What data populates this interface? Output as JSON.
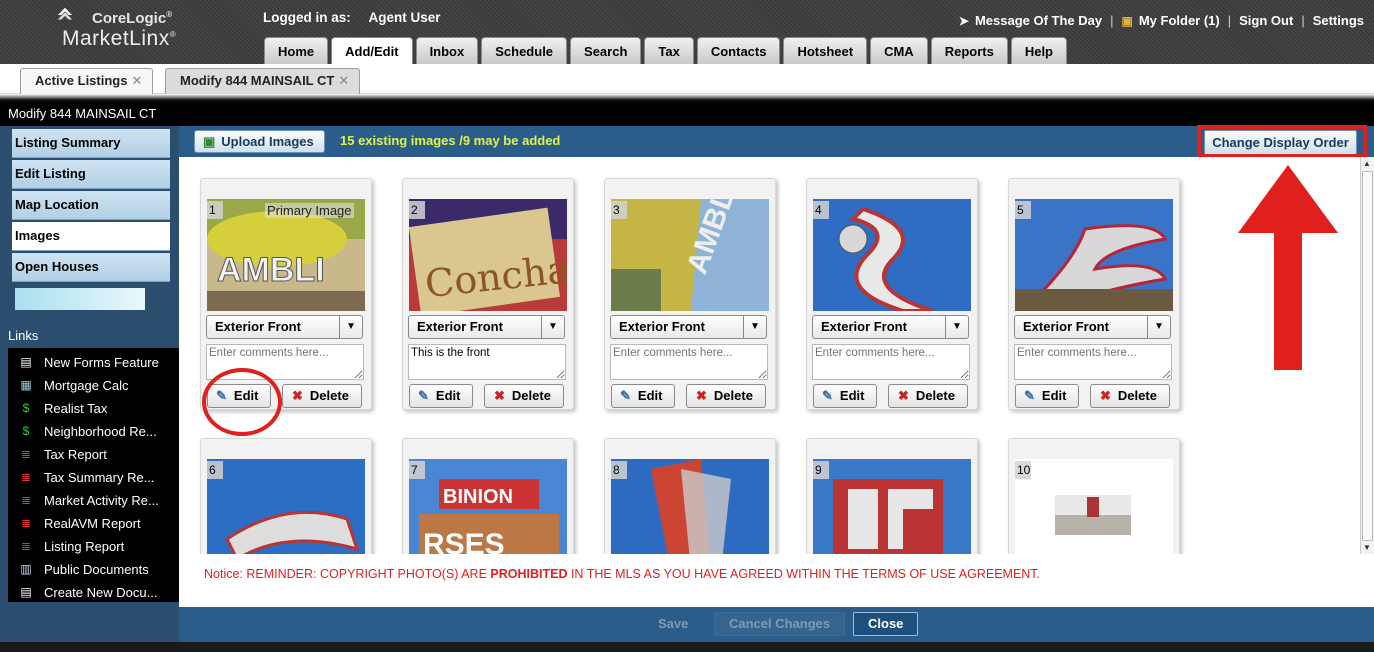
{
  "app": {
    "brand_top": "CoreLogic",
    "brand_bottom": "MarketLinx",
    "logged_label": "Logged in as:",
    "logged_user": "Agent User"
  },
  "toplinks": {
    "motd": "Message Of The Day",
    "folder": "My Folder (1)",
    "signout": "Sign Out",
    "settings": "Settings"
  },
  "nav": {
    "tabs": [
      "Home",
      "Add/Edit",
      "Inbox",
      "Schedule",
      "Search",
      "Tax",
      "Contacts",
      "Hotsheet",
      "CMA",
      "Reports",
      "Help"
    ],
    "active": "Add/Edit"
  },
  "doc_tabs": [
    {
      "label": "Active Listings"
    },
    {
      "label": "Modify 844 MAINSAIL CT"
    }
  ],
  "page_title": "Modify 844 MAINSAIL CT",
  "sidebar": {
    "items": [
      "Listing Summary",
      "Edit Listing",
      "Map Location",
      "Images",
      "Open Houses"
    ],
    "active": "Images",
    "links_header": "Links",
    "links": [
      {
        "label": "New Forms Feature",
        "icon": "document-icon"
      },
      {
        "label": "Mortgage Calc",
        "icon": "calculator-icon"
      },
      {
        "label": "Realist Tax",
        "icon": "dollar-icon"
      },
      {
        "label": "Neighborhood Re...",
        "icon": "dollar-icon"
      },
      {
        "label": "Tax Report",
        "icon": "report-icon"
      },
      {
        "label": "Tax Summary Re...",
        "icon": "report-icon"
      },
      {
        "label": "Market Activity Re...",
        "icon": "report-icon"
      },
      {
        "label": "RealAVM Report",
        "icon": "report-icon"
      },
      {
        "label": "Listing Report",
        "icon": "report-icon"
      },
      {
        "label": "Public Documents",
        "icon": "folder-doc-icon"
      },
      {
        "label": "Create New Docu...",
        "icon": "document-icon"
      }
    ]
  },
  "toolbar": {
    "upload_label": "Upload Images",
    "image_count": "15 existing images /9 may be added",
    "order_label": "Change Display Order"
  },
  "images": [
    {
      "num": "1",
      "primary": "Primary Image",
      "category": "Exterior Front",
      "comment": "",
      "placeholder": "Enter comments here..."
    },
    {
      "num": "2",
      "primary": "",
      "category": "Exterior Front",
      "comment": "This is the front",
      "placeholder": "Enter comments here..."
    },
    {
      "num": "3",
      "primary": "",
      "category": "Exterior Front",
      "comment": "",
      "placeholder": "Enter comments here..."
    },
    {
      "num": "4",
      "primary": "",
      "category": "Exterior Front",
      "comment": "",
      "placeholder": "Enter comments here..."
    },
    {
      "num": "5",
      "primary": "",
      "category": "Exterior Front",
      "comment": "",
      "placeholder": "Enter comments here..."
    },
    {
      "num": "6"
    },
    {
      "num": "7"
    },
    {
      "num": "8"
    },
    {
      "num": "9"
    },
    {
      "num": "10"
    }
  ],
  "card_buttons": {
    "edit": "Edit",
    "delete": "Delete"
  },
  "notice": {
    "prefix": "Notice: REMINDER: COPYRIGHT PHOTO(S) ARE ",
    "bold": "PROHIBITED",
    "suffix": " IN THE  MLS AS YOU HAVE AGREED WITHIN THE TERMS OF USE AGREEMENT."
  },
  "footer": {
    "save": "Save",
    "cancel": "Cancel Changes",
    "close": "Close"
  },
  "colors": {
    "accent_blue": "#2b5d8a",
    "annotation_red": "#e0201c",
    "count_yellow": "#e0f24a"
  }
}
